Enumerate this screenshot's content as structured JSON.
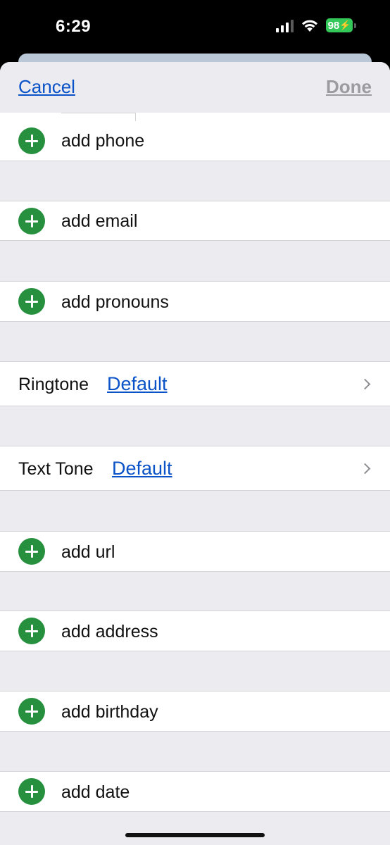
{
  "status_bar": {
    "time": "6:29",
    "battery": "98",
    "icons": [
      "signal-icon",
      "wifi-icon",
      "battery-charging-icon"
    ]
  },
  "nav": {
    "cancel_label": "Cancel",
    "done_label": "Done"
  },
  "rows": {
    "add_phone": "add phone",
    "add_email": "add email",
    "add_pronouns": "add pronouns",
    "ringtone_label": "Ringtone",
    "ringtone_value": "Default",
    "text_tone_label": "Text Tone",
    "text_tone_value": "Default",
    "add_url": "add url",
    "add_address": "add address",
    "add_birthday": "add birthday",
    "add_date": "add date"
  },
  "colors": {
    "accent_link": "#0a52c8",
    "add_green": "#26903f",
    "battery_green": "#34c759",
    "group_background": "#ebebf0"
  }
}
